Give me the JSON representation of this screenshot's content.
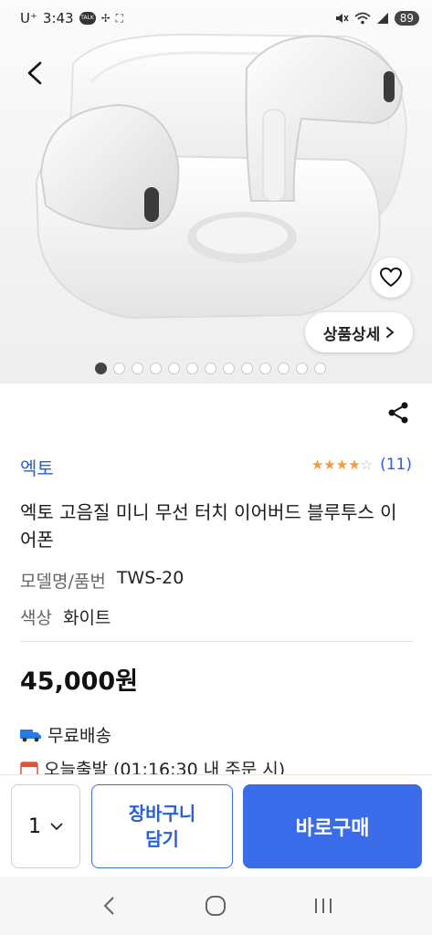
{
  "status_bar": {
    "carrier": "U⁺",
    "time": "3:43",
    "battery": "89",
    "left_icons": [
      "kakaotalk-icon",
      "pinwheel-icon",
      "screen-capture-icon"
    ],
    "right_icons": [
      "mute-icon",
      "wifi-icon",
      "signal-icon"
    ]
  },
  "hero": {
    "detail_button": "상품상세",
    "image_count": 13,
    "active_index": 0
  },
  "product": {
    "brand": "엑토",
    "rating_stars": 4,
    "rating_max": 5,
    "review_count": "(11)",
    "title": "엑토 고음질 미니 무선 터치 이어버드 블루투스 이어폰",
    "specs": [
      {
        "label": "모델명/품번",
        "value": "TWS-20"
      },
      {
        "label": "색상",
        "value": "화이트"
      }
    ],
    "price": "45,000원",
    "shipping": [
      {
        "icon": "truck-icon",
        "text": "무료배송"
      },
      {
        "icon": "calendar-icon",
        "text": "오늘출발 (01:16:30 내 주문 시)"
      }
    ]
  },
  "bottom_bar": {
    "quantity": "1",
    "cart_label": "장바구니\n담기",
    "buy_label": "바로구매"
  },
  "colors": {
    "accent": "#3a6be8",
    "brand_text": "#2a5ed8",
    "star": "#f39a3b"
  }
}
